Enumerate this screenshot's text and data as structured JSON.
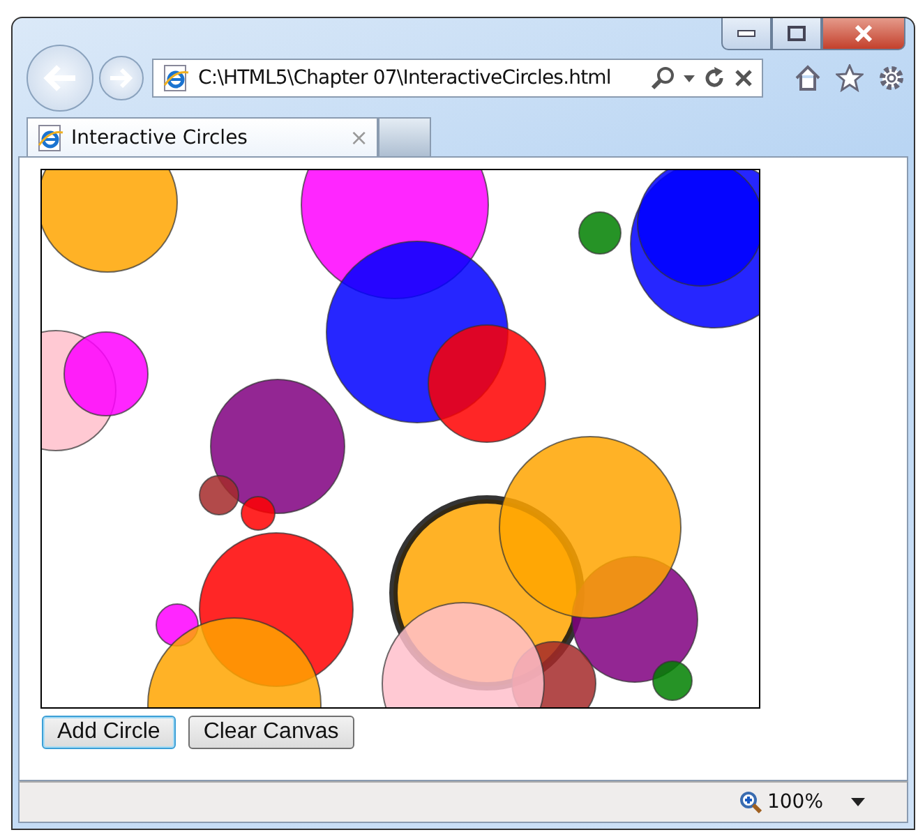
{
  "address_bar": {
    "url": "C:\\HTML5\\Chapter 07\\InteractiveCircles.html"
  },
  "tabs": [
    {
      "label": "Interactive Circles",
      "selected": true,
      "close": "×"
    }
  ],
  "buttons": [
    {
      "label": "Add Circle",
      "focused": true
    },
    {
      "label": "Clear Canvas",
      "focused": false
    }
  ],
  "status_bar": {
    "zoom": "100%"
  }
}
